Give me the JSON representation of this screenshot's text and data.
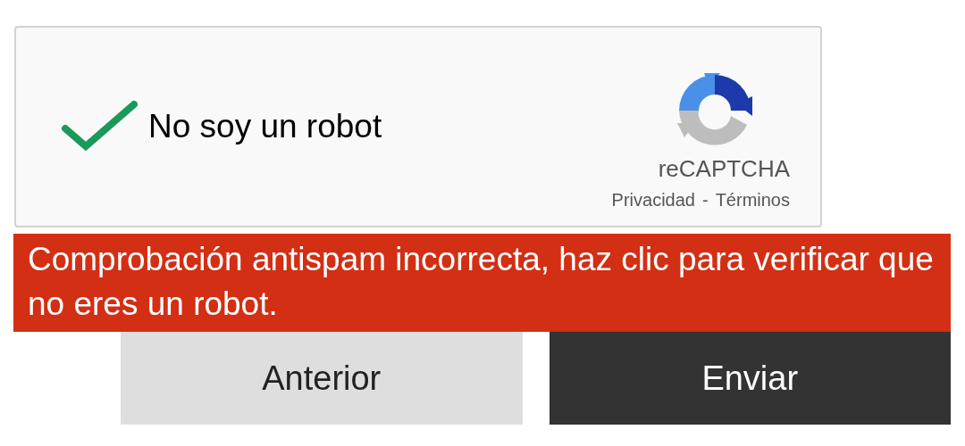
{
  "captcha": {
    "checked": true,
    "label": "No soy un robot",
    "brand": "reCAPTCHA",
    "links": [
      "Privacidad",
      "Términos"
    ],
    "separator": "-"
  },
  "error": {
    "message": "Comprobación antispam incorrecta, haz clic para verificar que no eres un robot."
  },
  "buttons": [
    {
      "label": "Anterior",
      "kind": "secondary"
    },
    {
      "label": "Enviar",
      "kind": "primary"
    }
  ]
}
